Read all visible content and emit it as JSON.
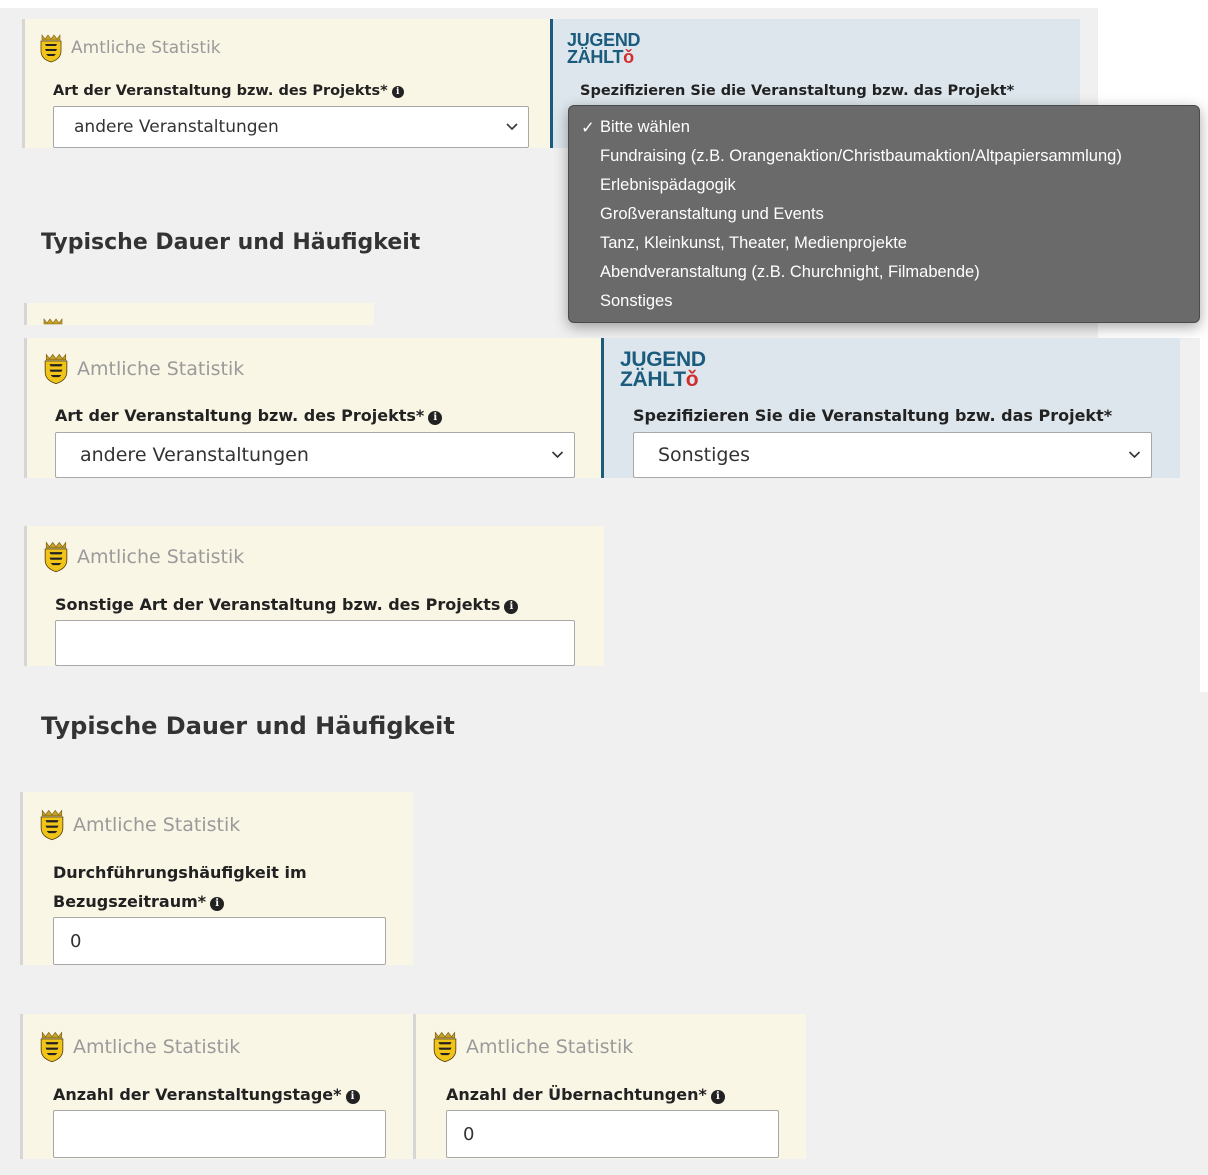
{
  "amtliche_label": "Amtliche Statistik",
  "jugend_logo": {
    "line1": "JUGEND",
    "line2": "ZÄHLT",
    "symbol": "ǒ"
  },
  "top_screenshot": {
    "art_label": "Art der Veranstaltung bzw. des Projekts*",
    "art_value": "andere Veranstaltungen",
    "spez_label": "Spezifizieren Sie die Veranstaltung bzw. das Projekt*",
    "dropdown": {
      "selected_marker": "✓",
      "options": [
        "Bitte wählen",
        "Fundraising (z.B. Orangenaktion/Christbaumaktion/Altpapiersammlung)",
        "Erlebnispädagogik",
        "Großveranstaltung und Events",
        "Tanz, Kleinkunst, Theater, Medienprojekte",
        "Abendveranstaltung (z.B. Churchnight, Filmabende)",
        "Sonstiges"
      ]
    },
    "section_title": "Typische Dauer und Häufigkeit"
  },
  "main_form": {
    "art_label": "Art der Veranstaltung bzw. des Projekts*",
    "art_value": "andere Veranstaltungen",
    "spez_label": "Spezifizieren Sie die Veranstaltung bzw. das Projekt*",
    "spez_value": "Sonstiges",
    "sonstige_label": "Sonstige Art der Veranstaltung bzw. des Projekts",
    "sonstige_value": "",
    "section_title": "Typische Dauer und Häufigkeit",
    "haeufigkeit_label_line1": "Durchführungshäufigkeit im",
    "haeufigkeit_label_line2": "Bezugszeitraum*",
    "haeufigkeit_value": "0",
    "tage_label": "Anzahl der Veranstaltungstage*",
    "tage_value": "",
    "uebernachtungen_label": "Anzahl der Übernachtungen*",
    "uebernachtungen_value": "0"
  },
  "info_icon_glyph": "i",
  "chevron_glyph": "⌄",
  "colors": {
    "amtlich_card": "#faf6e6",
    "jugend_card": "#dde6ec",
    "jugend_accent": "#1b5c7e",
    "jugend_symbol": "#d02d2d",
    "dropdown_bg": "#6a6a6a"
  }
}
